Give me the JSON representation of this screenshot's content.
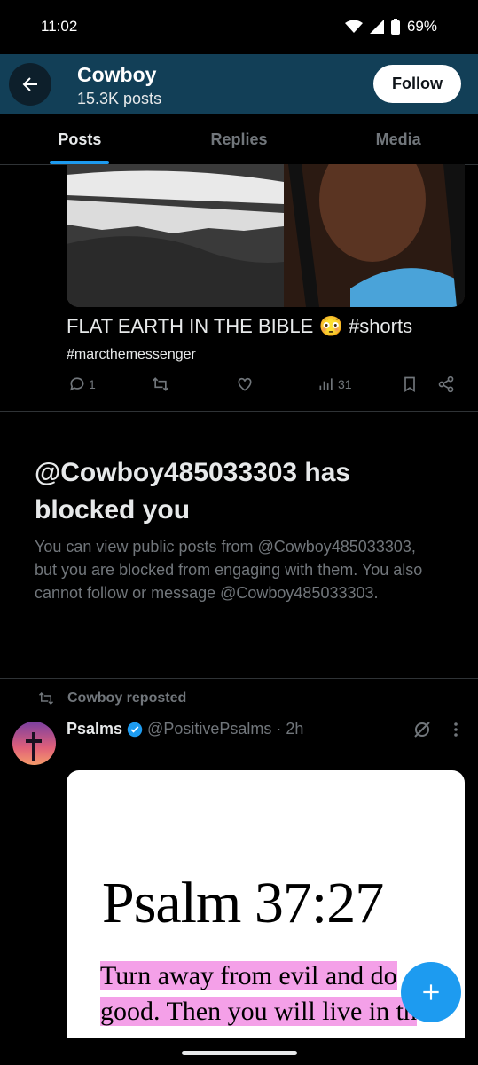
{
  "status": {
    "time": "11:02",
    "battery": "69%"
  },
  "header": {
    "title": "Cowboy",
    "subtitle": "15.3K posts",
    "follow_label": "Follow"
  },
  "tabs": [
    {
      "label": "Posts"
    },
    {
      "label": "Replies"
    },
    {
      "label": "Media"
    }
  ],
  "post1": {
    "title": "FLAT EARTH IN THE BIBLE 😳 #shorts",
    "tag": "#marcthemessenger",
    "replies": "1",
    "views": "31"
  },
  "blocked": {
    "title": "@Cowboy485033303 has blocked you",
    "text": "You can view public posts from @Cowboy485033303, but you are blocked from engaging with them. You also cannot follow or message @Cowboy485033303."
  },
  "post2": {
    "repost_label": "Cowboy reposted",
    "name": "Psalms",
    "handle": "@PositivePsalms · 2h",
    "image_title": "Psalm 37:27",
    "image_line1": "Turn away from evil and do",
    "image_line2": "good. Then you will live in th"
  },
  "colors": {
    "accent": "#1d9bf0",
    "header_bg": "#123f57",
    "highlight": "#f4a0e8"
  },
  "icons": [
    "back-arrow-icon",
    "wifi-icon",
    "signal-icon",
    "battery-icon",
    "reply-icon",
    "repost-icon",
    "like-icon",
    "views-icon",
    "bookmark-icon",
    "share-icon",
    "verified-icon",
    "grok-icon",
    "more-icon",
    "compose-icon"
  ]
}
